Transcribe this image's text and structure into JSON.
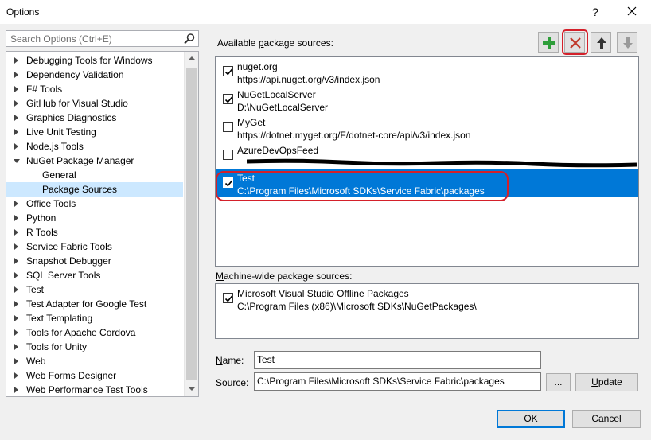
{
  "window": {
    "title": "Options",
    "help": "?",
    "close_icon": "close-icon"
  },
  "search": {
    "placeholder": "Search Options (Ctrl+E)",
    "icon": "search-icon"
  },
  "tree": {
    "items": [
      {
        "label": "Debugging Tools for Windows",
        "level": 0,
        "expanded": false
      },
      {
        "label": "Dependency Validation",
        "level": 0,
        "expanded": false
      },
      {
        "label": "F# Tools",
        "level": 0,
        "expanded": false
      },
      {
        "label": "GitHub for Visual Studio",
        "level": 0,
        "expanded": false
      },
      {
        "label": "Graphics Diagnostics",
        "level": 0,
        "expanded": false
      },
      {
        "label": "Live Unit Testing",
        "level": 0,
        "expanded": false
      },
      {
        "label": "Node.js Tools",
        "level": 0,
        "expanded": false
      },
      {
        "label": "NuGet Package Manager",
        "level": 0,
        "expanded": true
      },
      {
        "label": "General",
        "level": 1
      },
      {
        "label": "Package Sources",
        "level": 1,
        "selected": true
      },
      {
        "label": "Office Tools",
        "level": 0,
        "expanded": false
      },
      {
        "label": "Python",
        "level": 0,
        "expanded": false
      },
      {
        "label": "R Tools",
        "level": 0,
        "expanded": false
      },
      {
        "label": "Service Fabric Tools",
        "level": 0,
        "expanded": false
      },
      {
        "label": "Snapshot Debugger",
        "level": 0,
        "expanded": false
      },
      {
        "label": "SQL Server Tools",
        "level": 0,
        "expanded": false
      },
      {
        "label": "Test",
        "level": 0,
        "expanded": false
      },
      {
        "label": "Test Adapter for Google Test",
        "level": 0,
        "expanded": false
      },
      {
        "label": "Text Templating",
        "level": 0,
        "expanded": false
      },
      {
        "label": "Tools for Apache Cordova",
        "level": 0,
        "expanded": false
      },
      {
        "label": "Tools for Unity",
        "level": 0,
        "expanded": false
      },
      {
        "label": "Web",
        "level": 0,
        "expanded": false
      },
      {
        "label": "Web Forms Designer",
        "level": 0,
        "expanded": false
      },
      {
        "label": "Web Performance Test Tools",
        "level": 0,
        "expanded": false
      }
    ]
  },
  "available": {
    "label_pre": "Available ",
    "label_key": "p",
    "label_post": "ackage sources:",
    "toolbar": {
      "add_icon": "plus-icon",
      "remove_icon": "x-icon",
      "up_icon": "arrow-up-icon",
      "down_icon": "arrow-down-icon"
    },
    "sources": [
      {
        "name": "nuget.org",
        "url": "https://api.nuget.org/v3/index.json",
        "checked": true
      },
      {
        "name": "NuGetLocalServer",
        "url": "D:\\NuGetLocalServer",
        "checked": true
      },
      {
        "name": "MyGet",
        "url": "https://dotnet.myget.org/F/dotnet-core/api/v3/index.json",
        "checked": false
      },
      {
        "name": "AzureDevOpsFeed",
        "url": "",
        "checked": false
      },
      {
        "name": "Test",
        "url": "C:\\Program Files\\Microsoft SDKs\\Service Fabric\\packages",
        "checked": true,
        "selected": true
      }
    ]
  },
  "machine_wide": {
    "label_pre": "",
    "label_key": "M",
    "label_post": "achine-wide package sources:",
    "sources": [
      {
        "name": "Microsoft Visual Studio Offline Packages",
        "url": "C:\\Program Files (x86)\\Microsoft SDKs\\NuGetPackages\\",
        "checked": true
      }
    ]
  },
  "form": {
    "name_label_key": "N",
    "name_label_post": "ame:",
    "name_value": "Test",
    "source_label_key": "S",
    "source_label_post": "ource:",
    "source_value": "C:\\Program Files\\Microsoft SDKs\\Service Fabric\\packages",
    "browse_label": "...",
    "update_label_key": "U",
    "update_label_post": "pdate"
  },
  "footer": {
    "ok_label": "OK",
    "cancel_label": "Cancel"
  },
  "colors": {
    "selection": "#0078d7",
    "tree_selection": "#cce8ff",
    "annotation_red": "#d4202a",
    "add_green": "#2e9e3a"
  }
}
